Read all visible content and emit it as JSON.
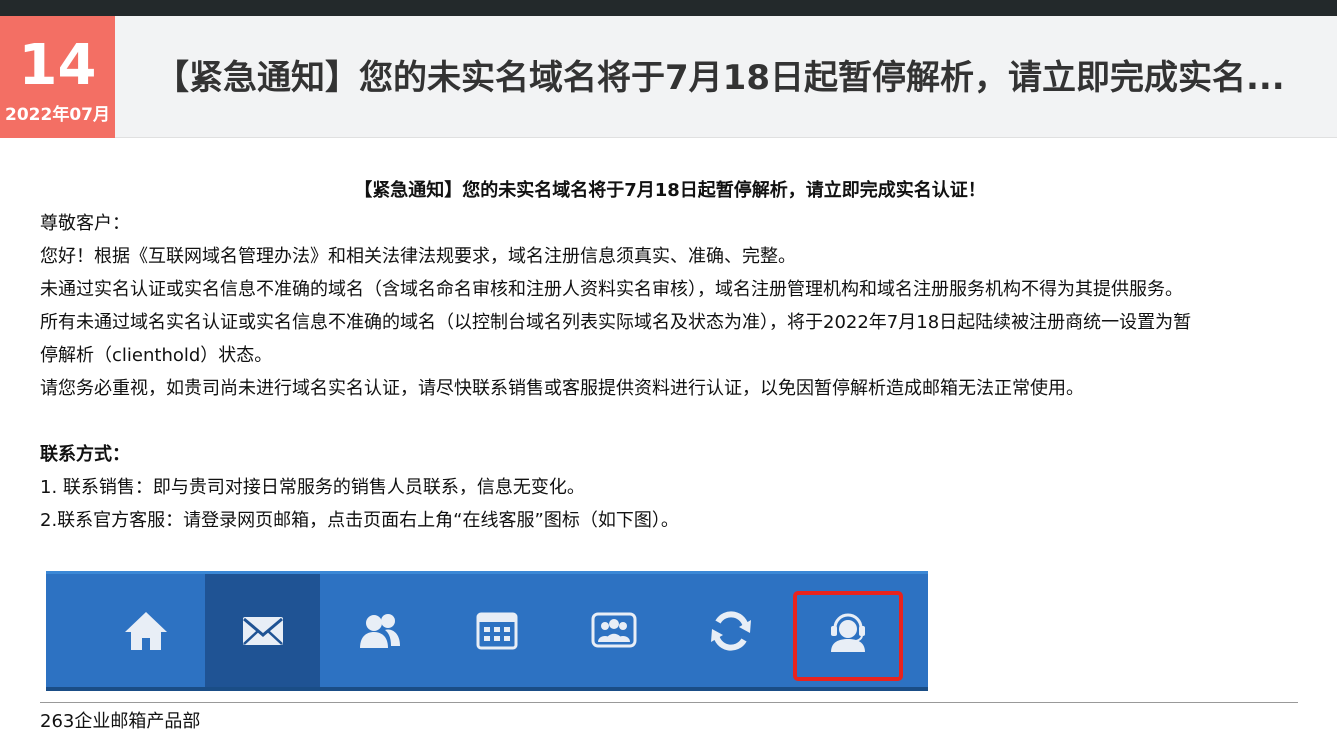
{
  "header": {
    "day": "14",
    "year_month": "2022年07月",
    "title": "【紧急通知】您的未实名域名将于7月18日起暂停解析，请立即完成实名..."
  },
  "article": {
    "title": "【紧急通知】您的未实名域名将于7月18日起暂停解析，请立即完成实名认证！",
    "greeting": "尊敬客户：",
    "p1": "您好！根据《互联网域名管理办法》和相关法律法规要求，域名注册信息须真实、准确、完整。",
    "p2": "未通过实名认证或实名信息不准确的域名（含域名命名审核和注册人资料实名审核），域名注册管理机构和域名注册服务机构不得为其提供服务。",
    "p3a": "所有未通过域名实名认证或实名信息不准确的域名（以控制台域名列表实际域名及状态为准），将于2022年7月18日起陆续被注册商统一设置为暂",
    "p3b": "停解析（clienthold）状态。",
    "p4": "请您务必重视，如贵司尚未进行域名实名认证，请尽快联系销售或客服提供资料进行认证，以免因暂停解析造成邮箱无法正常使用。",
    "contact_heading": "联系方式：",
    "contact1": "1. 联系销售：即与贵司对接日常服务的销售人员联系，信息无变化。",
    "contact2": "2.联系官方客服：请登录网页邮箱，点击页面右上角“在线客服”图标（如下图）。"
  },
  "toolbar_icons": [
    "home-icon",
    "mail-icon",
    "contacts-icon",
    "calendar-icon",
    "meeting-icon",
    "sync-icon",
    "customer-service-icon"
  ],
  "colors": {
    "date_box": "#f36f64",
    "toolbar": "#2d72c2",
    "toolbar_active": "#1f5394",
    "highlight": "#e8231d"
  },
  "footer": {
    "signature": "263企业邮箱产品部"
  }
}
